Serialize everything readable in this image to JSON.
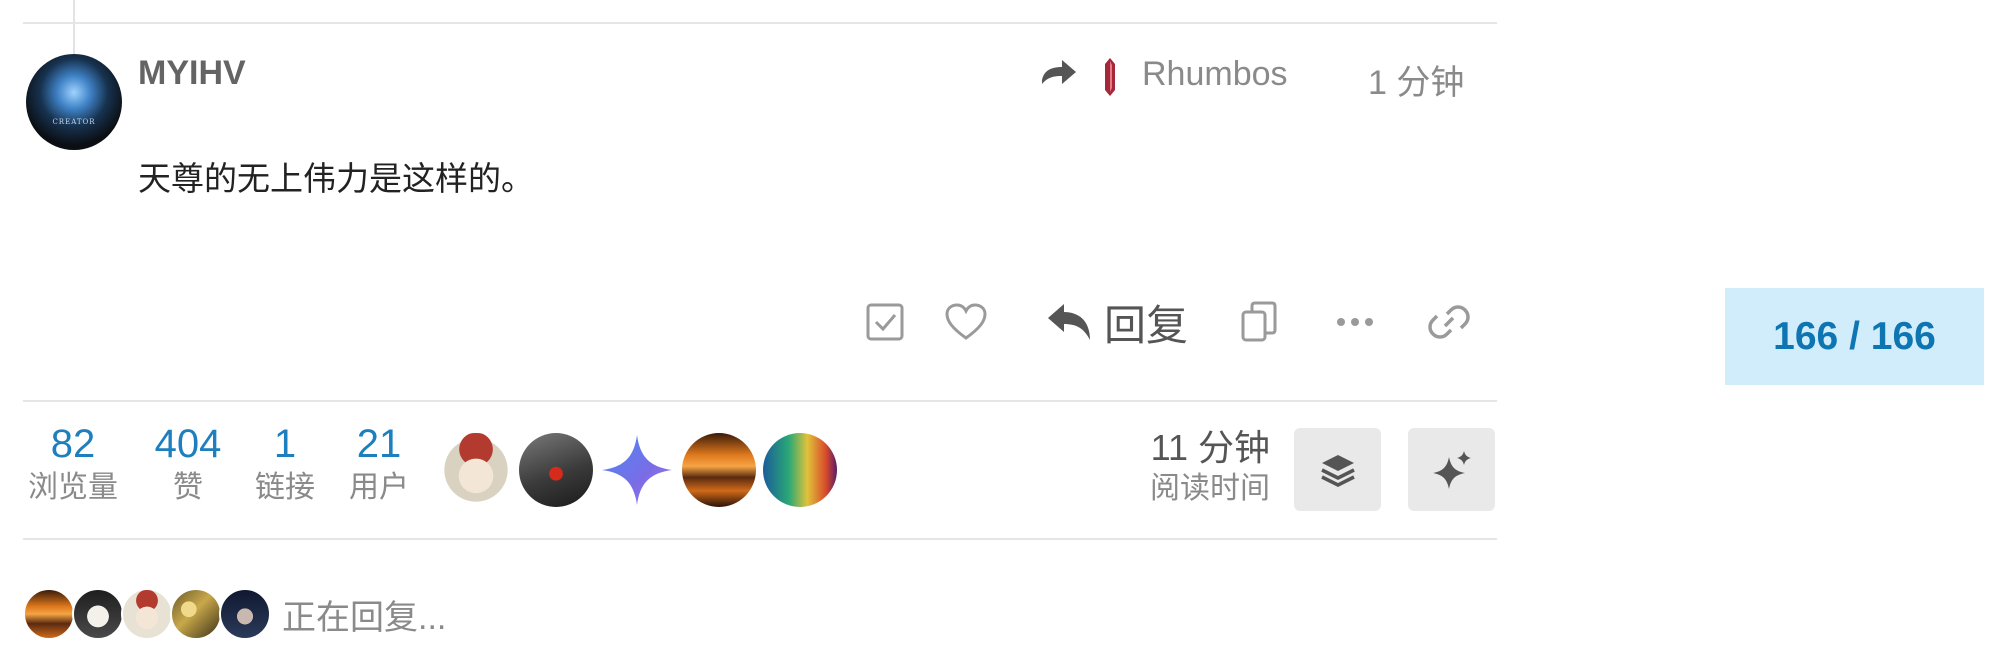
{
  "post": {
    "username": "MYIHV",
    "avatar_caption": "CREATOR",
    "reply_to_user": "Rhumbos",
    "time_ago": "1 分钟",
    "body": "天尊的无上伟力是这样的。",
    "actions": {
      "reply_label": "回复",
      "icons": [
        "checkbox-icon",
        "heart-icon",
        "reply-icon",
        "copy-icon",
        "more-icon",
        "link-icon"
      ]
    }
  },
  "progress": {
    "label": "166 / 166"
  },
  "topic_stats": {
    "views": {
      "value": "82",
      "label": "浏览量"
    },
    "likes": {
      "value": "404",
      "label": "赞"
    },
    "links": {
      "value": "1",
      "label": "链接"
    },
    "users": {
      "value": "21",
      "label": "用户"
    }
  },
  "read_time": {
    "value": "11 分钟",
    "label": "阅读时间"
  },
  "buttons": [
    "layers-icon",
    "sparkle-icon"
  ],
  "typing": {
    "text": "正在回复..."
  },
  "colors": {
    "accent_blue": "#1d7fbd",
    "progress_bg": "#d1ecfa",
    "progress_text": "#0e75b3",
    "muted_text": "#8a8a8a",
    "ruby": "#a3283a"
  }
}
